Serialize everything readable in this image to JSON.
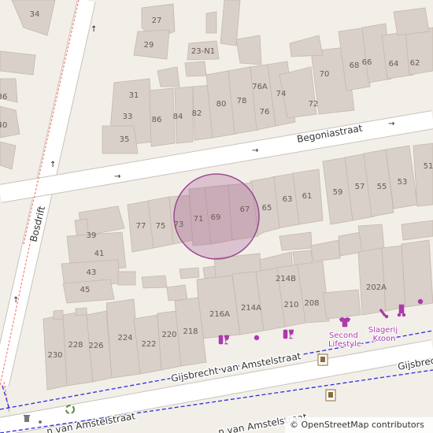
{
  "colors": {
    "land": "#f2efe9",
    "building": "#d9d0c9",
    "building_stroke": "#c5b8ad",
    "road": "#ffffff",
    "road_casing": "#c9c3bb",
    "footway": "#fa8072",
    "cycleway": "#2c2ce0",
    "marker_fill": "rgba(160,80,140,0.28)",
    "marker_stroke": "#9a4b8e",
    "poi": "#ac39ac",
    "label": "#6b5a55",
    "street_label": "#333333"
  },
  "streets": {
    "begoniastraat": "Begoniastraat",
    "bosdrift": "Bosdrift",
    "gijsbrecht_1": "Gijsbrecht van Amstelstraat",
    "gijsbrecht_2": "Gijsbrech",
    "gijsbrecht_3": "n van Amstelstraat"
  },
  "house_numbers": {
    "h34": "34",
    "h27": "27",
    "h29": "29",
    "h23n1": "23-N1",
    "h36": "36",
    "h40": "40",
    "h31": "31",
    "h33": "33",
    "h35": "35",
    "h86": "86",
    "h84": "84",
    "h82": "82",
    "h80": "80",
    "h78": "78",
    "h76a": "76A",
    "h76": "76",
    "h74": "74",
    "h72": "72",
    "h70": "70",
    "h68": "68",
    "h66": "66",
    "h64": "64",
    "h62": "62",
    "h59": "59",
    "h57": "57",
    "h55": "55",
    "h53": "53",
    "h51": "51",
    "h63": "63",
    "h61": "61",
    "h65": "65",
    "h67": "67",
    "h69": "69",
    "h71": "71",
    "h73": "73",
    "h75": "75",
    "h77": "77",
    "h39": "39",
    "h41": "41",
    "h43": "43",
    "h45": "45",
    "h214b": "214B",
    "h214a": "214A",
    "h210": "210",
    "h208": "208",
    "h216a": "216A",
    "h202a": "202A",
    "h230": "230",
    "h228": "228",
    "h226": "226",
    "h224": "224",
    "h222": "222",
    "h220": "220",
    "h218": "218"
  },
  "pois": {
    "second_lifestyle": "Second\nLifestyle",
    "slagerij_kroon": "Slagerij\nKroon"
  },
  "attribution": "© OpenStreetMap contributors"
}
